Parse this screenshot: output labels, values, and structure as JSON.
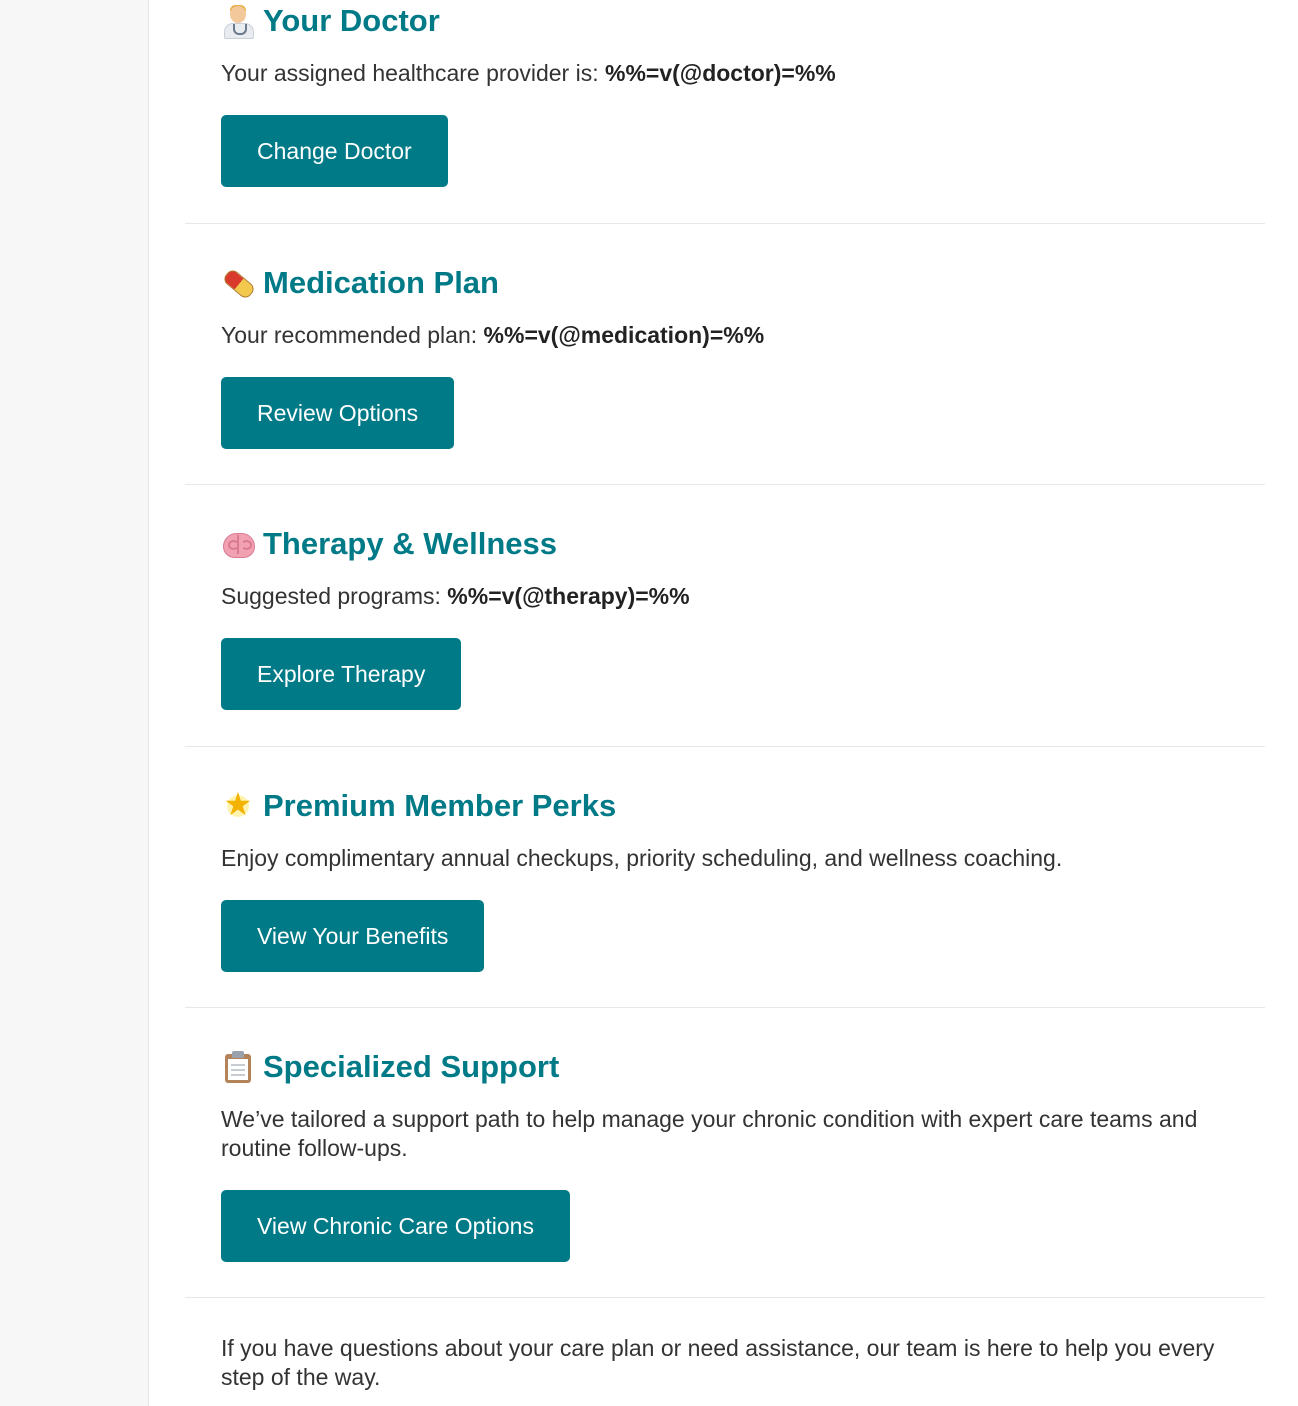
{
  "sections": [
    {
      "icon": "doctor-icon",
      "title": "Your Doctor",
      "text_prefix": "Your assigned healthcare provider is: ",
      "text_value": "%%=v(@doctor)=%%",
      "button": "Change Doctor"
    },
    {
      "icon": "pill-icon",
      "title": "Medication Plan",
      "text_prefix": "Your recommended plan: ",
      "text_value": "%%=v(@medication)=%%",
      "button": "Review Options"
    },
    {
      "icon": "brain-icon",
      "title": "Therapy & Wellness",
      "text_prefix": "Suggested programs: ",
      "text_value": "%%=v(@therapy)=%%",
      "button": "Explore Therapy"
    },
    {
      "icon": "star-icon",
      "title": "Premium Member Perks",
      "text": "Enjoy complimentary annual checkups, priority scheduling, and wellness coaching.",
      "button": "View Your Benefits"
    },
    {
      "icon": "clipboard-icon",
      "title": "Specialized Support",
      "text": "We’ve tailored a support path to help manage your chronic condition with expert care teams and routine follow-ups.",
      "button": "View Chronic Care Options"
    }
  ],
  "footer": {
    "text": "If you have questions about your care plan or need assistance, our team is here to help you every step of the way."
  },
  "colors": {
    "accent": "#007a87",
    "text": "#333333",
    "sidebar": "#f7f7f7",
    "divider": "#e8e8e8"
  }
}
